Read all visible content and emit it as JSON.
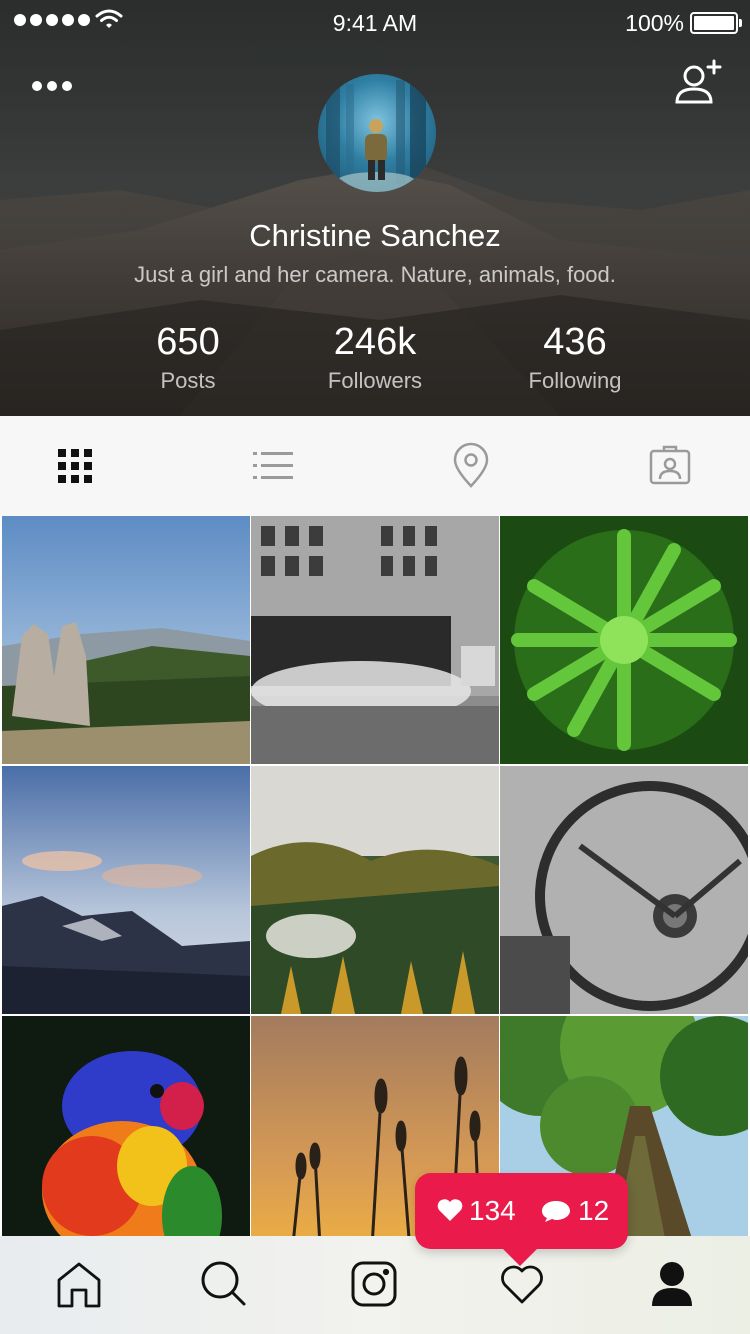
{
  "status_bar": {
    "time": "9:41 AM",
    "battery": "100%"
  },
  "profile": {
    "name": "Christine Sanchez",
    "bio": "Just a girl and her camera. Nature, animals, food.",
    "stats": [
      {
        "value": "650",
        "label": "Posts"
      },
      {
        "value": "246k",
        "label": "Followers"
      },
      {
        "value": "436",
        "label": "Following"
      }
    ]
  },
  "view_tabs": [
    {
      "icon": "grid-icon",
      "active": true
    },
    {
      "icon": "list-icon",
      "active": false
    },
    {
      "icon": "location-pin-icon",
      "active": false
    },
    {
      "icon": "tagged-photos-icon",
      "active": false
    }
  ],
  "photos": [
    "rocky-mountain-forest",
    "city-street-steam-bw",
    "green-fern-plant",
    "mountains-dusk-sky",
    "foggy-autumn-forest",
    "vintage-steering-wheel",
    "rainbow-lorikeet",
    "grass-sunset-silhouette",
    "tree-trunk-canopy"
  ],
  "activity": {
    "likes": "134",
    "comments": "12"
  },
  "bottom_nav": [
    "home-icon",
    "search-icon",
    "camera-icon",
    "heart-icon",
    "profile-icon"
  ],
  "colors": {
    "accent": "#ea1a4a",
    "tab_bar": "#f7f7f7",
    "icon_dark": "#111111",
    "icon_muted": "#9a9a9a"
  }
}
